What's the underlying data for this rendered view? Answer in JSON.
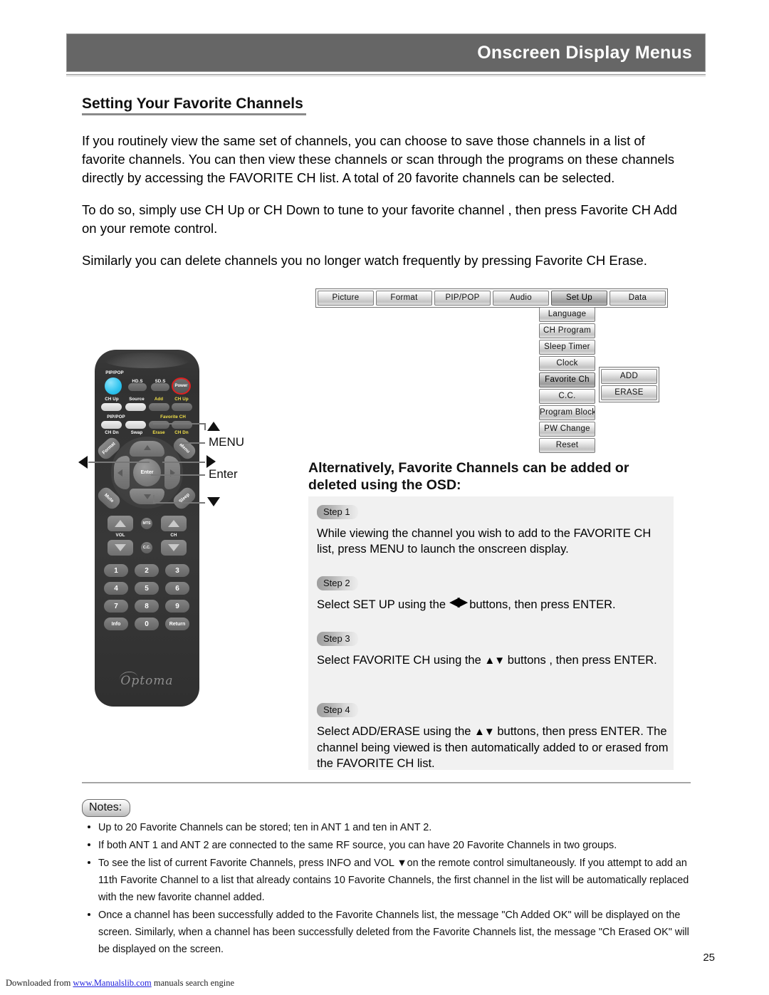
{
  "header": {
    "title": "Onscreen Display Menus"
  },
  "section": {
    "title": "Setting Your Favorite Channels"
  },
  "paragraphs": {
    "p1": "If you routinely view the same set of channels, you can choose to save those channels in a list of favorite channels. You can then view these channels or scan through the programs on these channels directly by accessing the FAVORITE CH list. A total of 20 favorite channels can be selected.",
    "p2": "To do so, simply use CH Up or CH Down to tune to your favorite channel , then press Favorite CH Add on your remote control.",
    "p3": "Similarly you can delete channels you no longer watch frequently by pressing Favorite CH Erase."
  },
  "osd": {
    "top_menu": [
      "Picture",
      "Format",
      "PIP/POP",
      "Audio",
      "Set Up",
      "Data"
    ],
    "selected_top": "Set Up",
    "submenu": [
      "Language",
      "CH Program",
      "Sleep Timer",
      "Clock",
      "Favorite Ch",
      "C.C.",
      "Program Block",
      "PW Change",
      "Reset"
    ],
    "selected_sub": "Favorite Ch",
    "leaf_menu": [
      "ADD",
      "ERASE"
    ]
  },
  "remote": {
    "labels": {
      "pip_pop_top": "PIP/POP",
      "hd_s": "HD.S",
      "sd_s": "SD.S",
      "power": "Power",
      "ch_up_left": "CH Up",
      "source": "Source",
      "add": "Add",
      "ch_up_right": "CH Up",
      "pip_pop_mid": "PIP/POP",
      "favorite_ch": "Favorite CH",
      "ch_dn_left": "CH Dn",
      "swap": "Swap",
      "erase": "Erase",
      "ch_dn_right": "CH Dn",
      "format": "Format",
      "menu": "Menu",
      "enter": "Enter",
      "mute": "Mute",
      "sleep": "Sleep",
      "vol": "VOL",
      "ch": "CH",
      "mts": "MTS",
      "cc": "C.C.",
      "info": "Info",
      "zero": "0",
      "return": "Return",
      "brand": "Optoma"
    },
    "numbers": [
      "1",
      "2",
      "3",
      "4",
      "5",
      "6",
      "7",
      "8",
      "9"
    ]
  },
  "callouts": {
    "up": "▲",
    "menu": "MENU",
    "right": "▶",
    "enter": "Enter",
    "down": "▼",
    "left": "◀"
  },
  "alt_heading": "Alternatively, Favorite Channels can be added or deleted using the OSD:",
  "steps": [
    {
      "badge": "Step 1",
      "text": "While viewing the channel you wish to add to the FAVORITE CH list, press MENU to launch the onscreen display."
    },
    {
      "badge": "Step 2",
      "text_before": "Select SET UP using the",
      "glyph": "◀▶",
      "text_after": "buttons, then press ENTER."
    },
    {
      "badge": "Step 3",
      "text_before": "Select FAVORITE CH using the",
      "glyph": "▲▼",
      "text_after": "buttons , then press ENTER."
    },
    {
      "badge": "Step 4",
      "text_before": "Select ADD/ERASE using the",
      "glyph": "▲▼",
      "text_after": "buttons, then press ENTER. The channel being viewed is then automatically added to or erased from the FAVORITE CH list."
    }
  ],
  "notes": {
    "badge": "Notes:",
    "items": [
      "Up to 20 Favorite Channels can be stored; ten in ANT 1 and ten in ANT 2.",
      "If both ANT 1 and ANT 2 are connected to the same RF source, you can have 20 Favorite Channels in two groups.",
      "To see the list of current Favorite Channels, press INFO and VOL ▼on the remote control simultaneously. If you attempt to add an 11th Favorite Channel to a list that already contains 10 Favorite Channels, the first channel in the list will be automatically replaced with the new favorite channel added.",
      "Once a channel has been successfully added to the Favorite Channels list, the message \"Ch Added OK\" will be displayed on the screen. Similarly, when a channel has been successfully deleted from the Favorite Channels list, the message \"Ch Erased OK\" will be displayed on the screen."
    ]
  },
  "page_number": "25",
  "footer": {
    "prefix": "Downloaded from ",
    "link": "www.Manualslib.com",
    "suffix": " manuals search engine"
  },
  "colors": {
    "header_bg": "#666666",
    "panel_bg": "#f1f1f1",
    "accent_yellow": "#f2e14a",
    "power_ring": "#e02020",
    "pip_cyan": "#2ec3ef",
    "link": "#2222dd"
  }
}
